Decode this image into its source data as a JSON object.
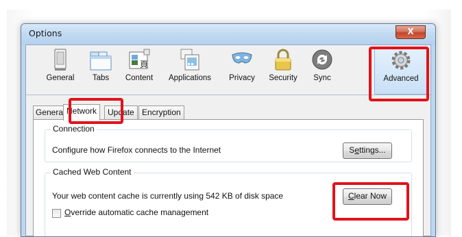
{
  "window": {
    "title": "Options",
    "close_label": "X"
  },
  "toolbar": {
    "items": [
      {
        "label": "General",
        "icon": "general-icon"
      },
      {
        "label": "Tabs",
        "icon": "tabs-icon"
      },
      {
        "label": "Content",
        "icon": "content-icon"
      },
      {
        "label": "Applications",
        "icon": "applications-icon"
      },
      {
        "label": "Privacy",
        "icon": "privacy-mask-icon"
      },
      {
        "label": "Security",
        "icon": "padlock-icon"
      },
      {
        "label": "Sync",
        "icon": "sync-icon"
      },
      {
        "label": "Advanced",
        "icon": "gear-icon"
      }
    ],
    "selected": "Advanced"
  },
  "tabs": [
    "Genera",
    "Network",
    "Update",
    "Encryption"
  ],
  "active_tab": "Network",
  "connection": {
    "legend": "Connection",
    "text": "Configure how Firefox connects to the Internet",
    "button_pre": "S",
    "button_u": "e",
    "button_post": "ttings..."
  },
  "cache": {
    "legend": "Cached Web Content",
    "text": "Your web content cache is currently using 542 KB of disk space",
    "button_pre": "",
    "button_u": "C",
    "button_post": "lear Now",
    "override_pre": "",
    "override_u": "O",
    "override_post": "verride automatic cache management"
  },
  "colors": {
    "highlight": "#e0131c",
    "accent": "#bcd6ee"
  }
}
